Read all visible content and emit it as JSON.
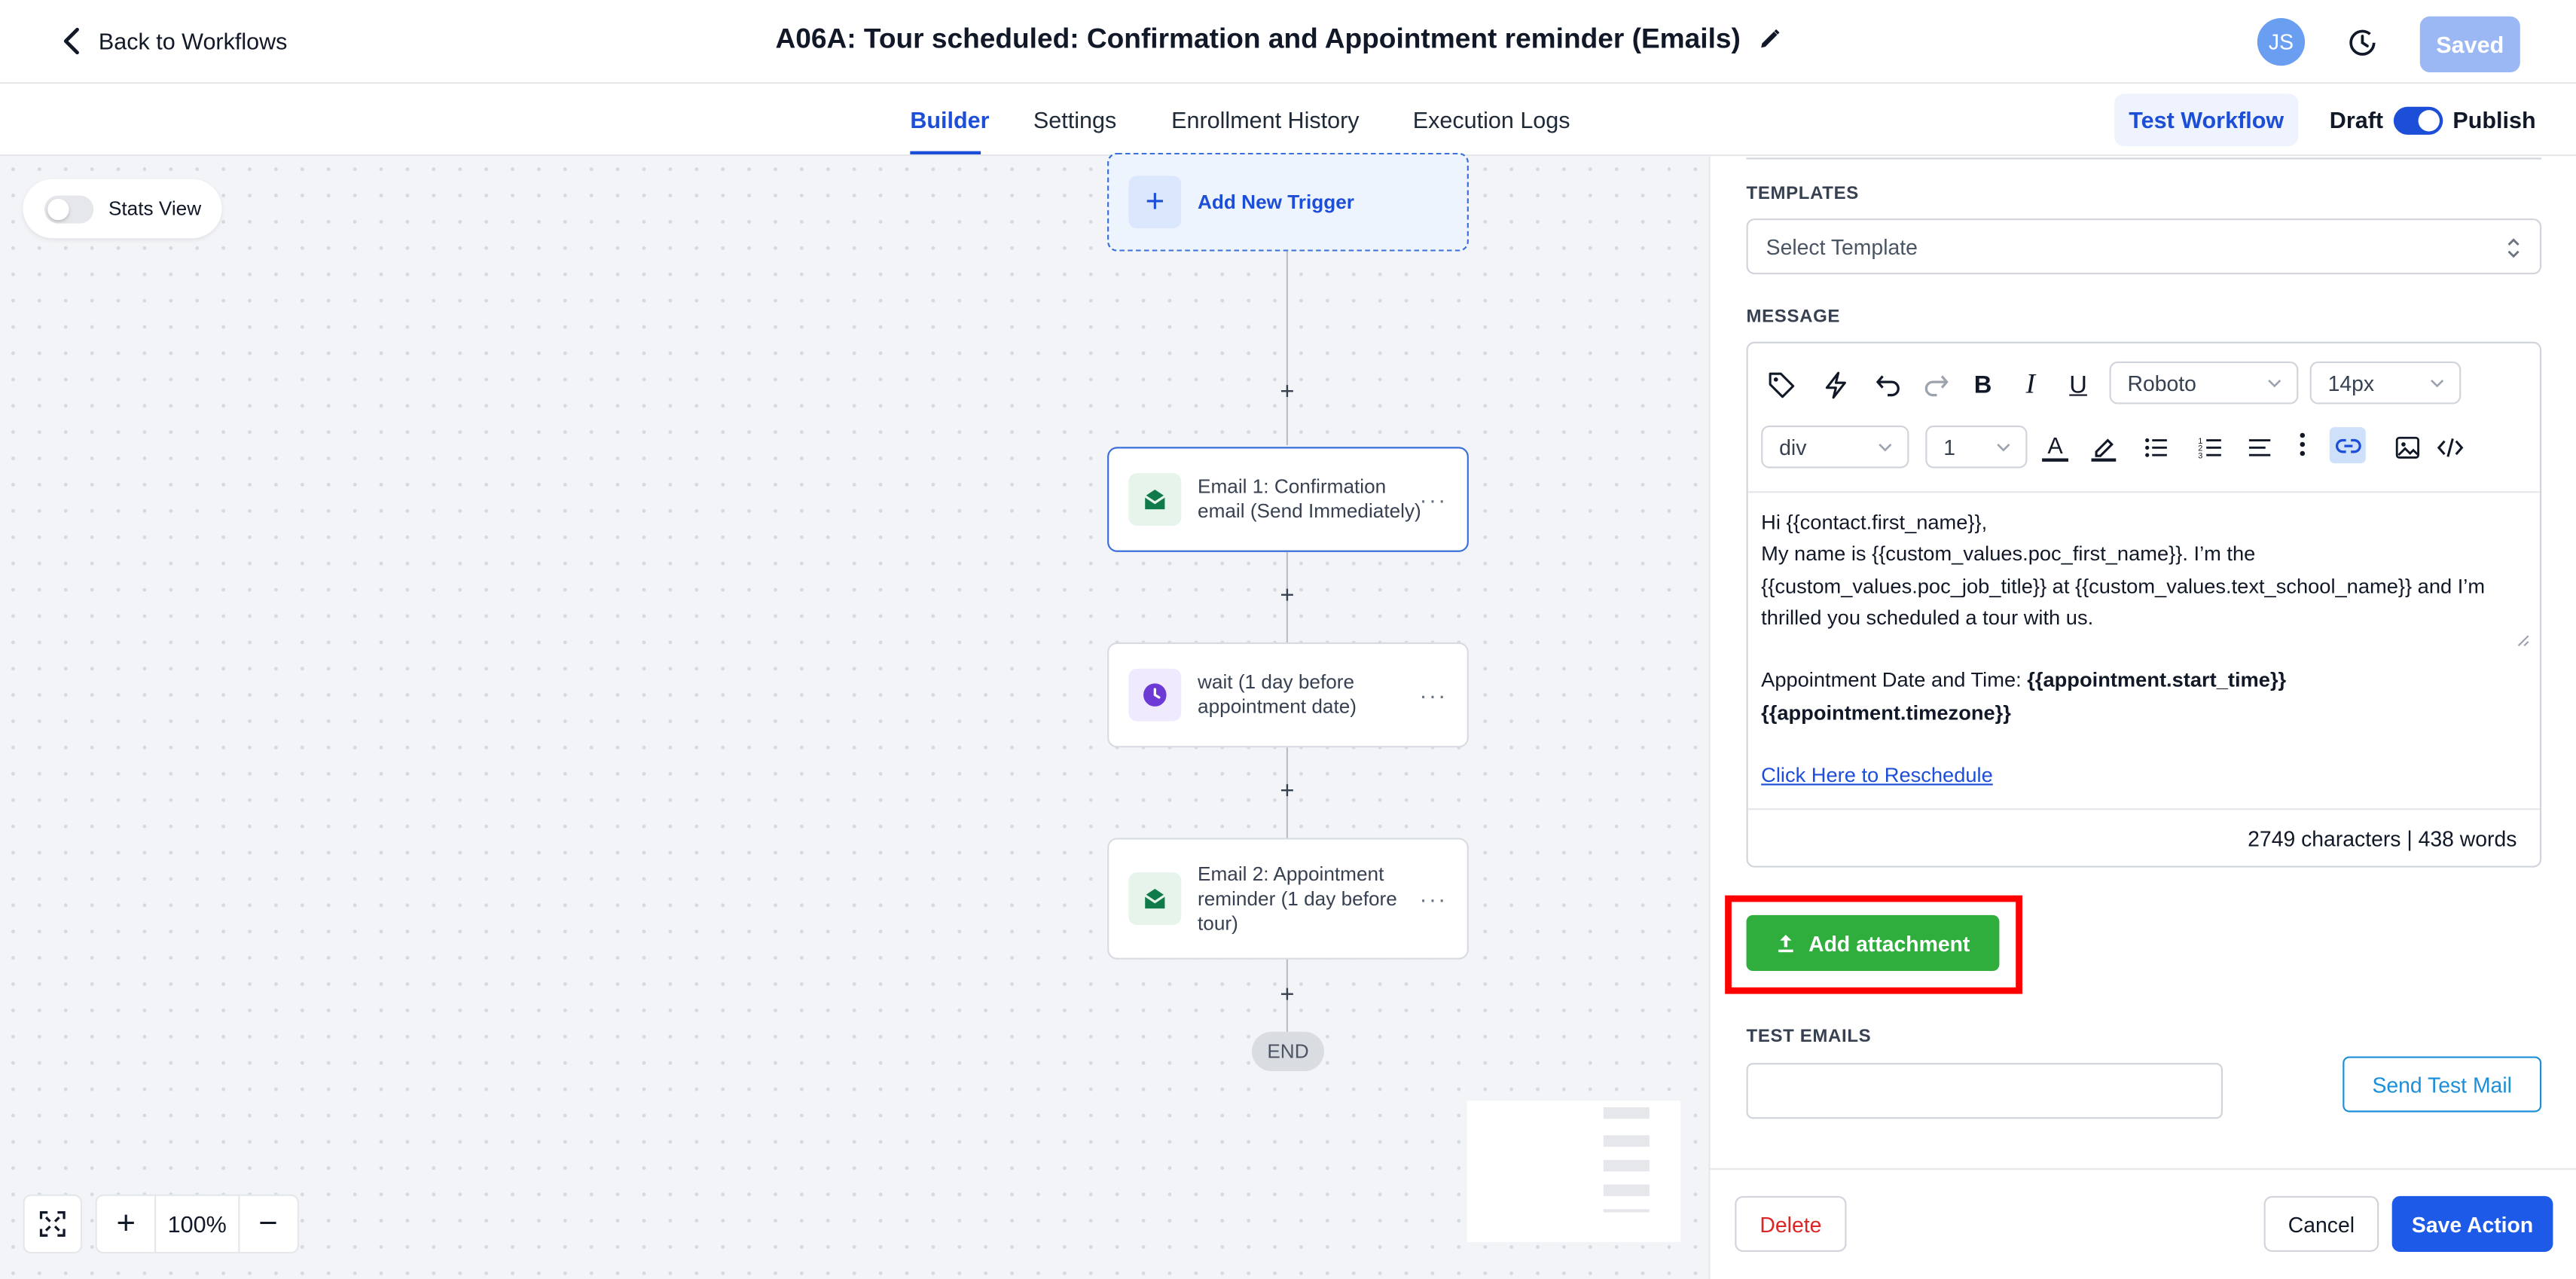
{
  "header": {
    "back_label": "Back to Workflows",
    "title": "A06A: Tour scheduled: Confirmation and Appointment reminder (Emails)",
    "avatar_initials": "JS",
    "saved_label": "Saved"
  },
  "subnav": {
    "tabs": [
      {
        "label": "Builder",
        "active": true
      },
      {
        "label": "Settings",
        "active": false
      },
      {
        "label": "Enrollment History",
        "active": false
      },
      {
        "label": "Execution Logs",
        "active": false
      }
    ],
    "test_workflow_label": "Test Workflow",
    "draft_label": "Draft",
    "publish_label": "Publish",
    "published": true
  },
  "canvas": {
    "stats_view_label": "Stats View",
    "stats_view_enabled": false,
    "trigger_label": "Add New Trigger",
    "nodes": [
      {
        "label": "Email 1: Confirmation email (Send Immediately)",
        "type": "email",
        "selected": true
      },
      {
        "label": "wait (1 day before appointment date)",
        "type": "wait",
        "selected": false
      },
      {
        "label": "Email 2: Appointment reminder (1 day before tour)",
        "type": "email",
        "selected": false
      }
    ],
    "end_label": "END",
    "zoom_level": "100%",
    "icons": [
      "expand-icon",
      "zoom-in-icon",
      "zoom-out-icon",
      "email-icon",
      "clock-icon",
      "more-icon"
    ]
  },
  "panel": {
    "templates_label": "TEMPLATES",
    "template_placeholder": "Select Template",
    "message_label": "MESSAGE",
    "toolbar": {
      "font_family": "Roboto",
      "font_size": "14px",
      "block_type": "div",
      "line_height": "1",
      "bold": "B",
      "italic": "I",
      "underline": "U",
      "font_color_letter": "A"
    },
    "message": {
      "line1": "Hi {{contact.first_name}},",
      "line2": "My name is {{custom_values.poc_first_name}}. I’m the",
      "line3": "{{custom_values.poc_job_title}} at {{custom_values.text_school_name}} and I’m",
      "line4": "thrilled you scheduled a tour with us.",
      "line5_prefix": "Appointment Date and Time: ",
      "line5_bold": "{{appointment.start_time}}",
      "line6_bold": "{{appointment.timezone}}",
      "link_text": "Click Here to Reschedule"
    },
    "counts": "2749 characters | 438 words",
    "add_attachment_label": "Add attachment",
    "test_emails_label": "TEST EMAILS",
    "test_emails_value": "",
    "send_test_label": "Send Test Mail",
    "delete_label": "Delete",
    "cancel_label": "Cancel",
    "save_label": "Save Action"
  },
  "colors": {
    "primary": "#1d4ed8",
    "success": "#2fae3e",
    "danger": "#dc2626",
    "highlight_frame": "#ff0000"
  }
}
